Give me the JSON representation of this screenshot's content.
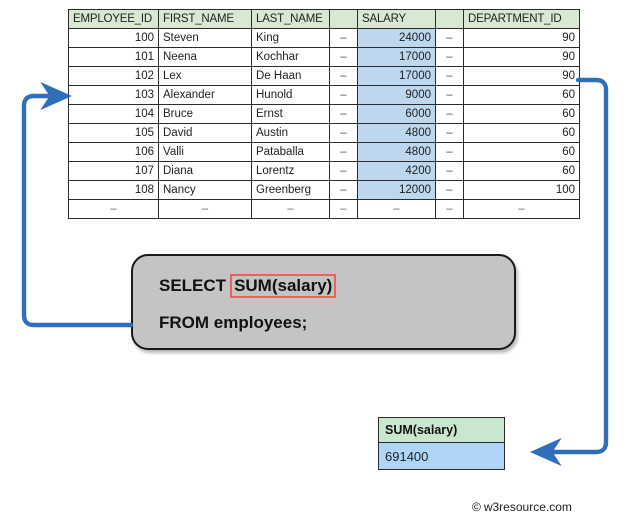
{
  "employees_table": {
    "name": "employees",
    "columns": [
      {
        "key": "employee_id",
        "label": "EMPLOYEE_ID"
      },
      {
        "key": "first_name",
        "label": "FIRST_NAME"
      },
      {
        "key": "last_name",
        "label": "LAST_NAME"
      },
      {
        "key": "gap1",
        "label": ""
      },
      {
        "key": "salary",
        "label": "SALARY"
      },
      {
        "key": "gap2",
        "label": ""
      },
      {
        "key": "department_id",
        "label": "DEPARTMENT_ID"
      }
    ],
    "dash": "–",
    "rows": [
      {
        "employee_id": "100",
        "first_name": "Steven",
        "last_name": "King",
        "gap1": "–",
        "salary": "24000",
        "gap2": "–",
        "department_id": "90"
      },
      {
        "employee_id": "101",
        "first_name": "Neena",
        "last_name": "Kochhar",
        "gap1": "–",
        "salary": "17000",
        "gap2": "–",
        "department_id": "90"
      },
      {
        "employee_id": "102",
        "first_name": "Lex",
        "last_name": "De Haan",
        "gap1": "–",
        "salary": "17000",
        "gap2": "–",
        "department_id": "90"
      },
      {
        "employee_id": "103",
        "first_name": "Alexander",
        "last_name": "Hunold",
        "gap1": "–",
        "salary": "9000",
        "gap2": "–",
        "department_id": "60"
      },
      {
        "employee_id": "104",
        "first_name": "Bruce",
        "last_name": "Ernst",
        "gap1": "–",
        "salary": "6000",
        "gap2": "–",
        "department_id": "60"
      },
      {
        "employee_id": "105",
        "first_name": "David",
        "last_name": "Austin",
        "gap1": "–",
        "salary": "4800",
        "gap2": "–",
        "department_id": "60"
      },
      {
        "employee_id": "106",
        "first_name": "Valli",
        "last_name": "Pataballa",
        "gap1": "–",
        "salary": "4800",
        "gap2": "–",
        "department_id": "60"
      },
      {
        "employee_id": "107",
        "first_name": "Diana",
        "last_name": "Lorentz",
        "gap1": "–",
        "salary": "4200",
        "gap2": "–",
        "department_id": "60"
      },
      {
        "employee_id": "108",
        "first_name": "Nancy",
        "last_name": "Greenberg",
        "gap1": "–",
        "salary": "12000",
        "gap2": "–",
        "department_id": "100"
      },
      {
        "employee_id": "–",
        "first_name": "–",
        "last_name": "–",
        "gap1": "–",
        "salary": "–",
        "gap2": "–",
        "department_id": "–"
      }
    ]
  },
  "sql": {
    "keyword_select": "SELECT",
    "highlighted_expression": "SUM(salary)",
    "line2": "FROM employees;"
  },
  "result": {
    "header": "SUM(salary)",
    "value": "691400"
  },
  "footer": {
    "copyright_symbol": "©",
    "text": "w3resource.com"
  },
  "colors": {
    "table_header_green": "#d9e8d2",
    "salary_highlight_blue": "#bdd7ee",
    "result_header_green": "#c9e7ce",
    "result_value_blue": "#aed4f7",
    "sql_box_gray": "#c4c4c4",
    "sql_highlight_red": "#e8645a",
    "arrow_blue": "#2f6fba",
    "border_dark": "#2b2b2b"
  }
}
